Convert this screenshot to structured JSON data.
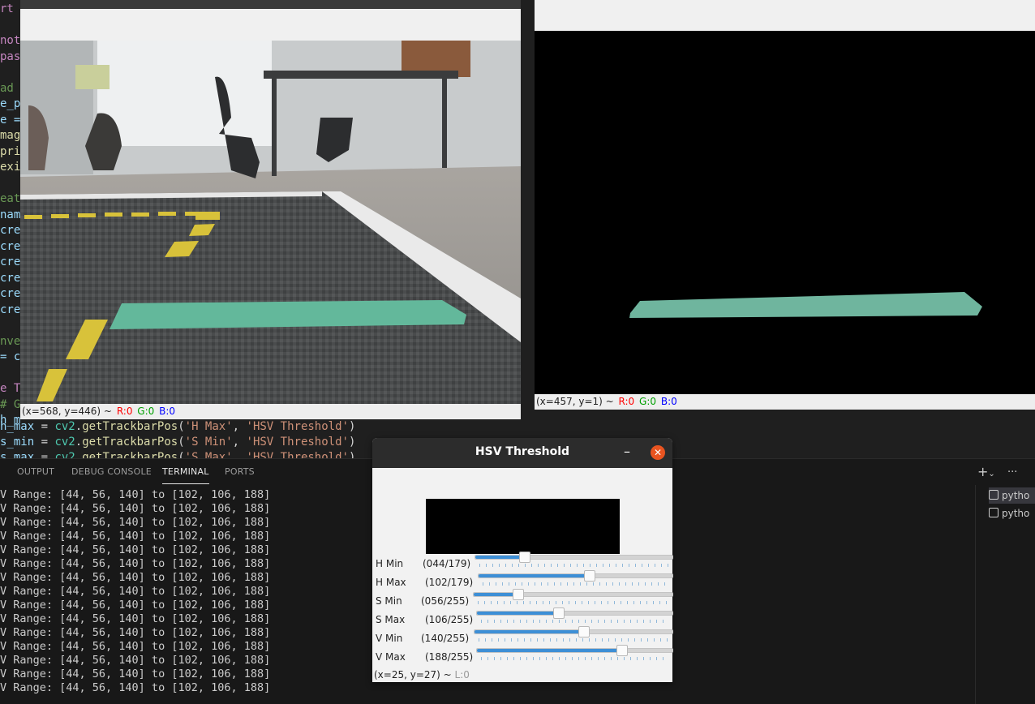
{
  "editor": {
    "lines": [
      {
        "t": "rt",
        "c": "#c586c0"
      },
      {
        "t": "",
        "c": "#d4d4d4"
      },
      {
        "t": "not",
        "c": "#c586c0"
      },
      {
        "t": "pas",
        "c": "#c586c0"
      },
      {
        "t": "",
        "c": "#d4d4d4"
      },
      {
        "t": "ad",
        "c": "#6a9955"
      },
      {
        "t": "e_p",
        "c": "#9cdcfe"
      },
      {
        "t": "e =",
        "c": "#9cdcfe"
      },
      {
        "t": "mag",
        "c": "#dcdcaa"
      },
      {
        "t": "pri",
        "c": "#dcdcaa"
      },
      {
        "t": "exi",
        "c": "#dcdcaa"
      },
      {
        "t": "",
        "c": "#d4d4d4"
      },
      {
        "t": "eat",
        "c": "#6a9955"
      },
      {
        "t": "nam",
        "c": "#9cdcfe"
      },
      {
        "t": "cre",
        "c": "#9cdcfe"
      },
      {
        "t": "cre",
        "c": "#9cdcfe"
      },
      {
        "t": "cre",
        "c": "#9cdcfe"
      },
      {
        "t": "cre",
        "c": "#9cdcfe"
      },
      {
        "t": "cre",
        "c": "#9cdcfe"
      },
      {
        "t": "cre",
        "c": "#9cdcfe"
      },
      {
        "t": "",
        "c": "#d4d4d4"
      },
      {
        "t": "nve",
        "c": "#6a9955"
      },
      {
        "t": "= c",
        "c": "#9cdcfe"
      },
      {
        "t": "",
        "c": "#d4d4d4"
      },
      {
        "t": "e T",
        "c": "#c586c0"
      },
      {
        "t": "# G",
        "c": "#6a9955"
      },
      {
        "t": "h_m",
        "c": "#9cdcfe"
      }
    ],
    "visible_code": [
      "h_max = cv2.getTrackbarPos('H Max', 'HSV Threshold')",
      "s_min = cv2.getTrackbarPos('S Min', 'HSV Threshold')",
      "s_max = cv2.getTrackbarPos('S Max', 'HSV Threshold')"
    ]
  },
  "panel": {
    "tabs": [
      "OUTPUT",
      "DEBUG CONSOLE",
      "TERMINAL",
      "PORTS"
    ],
    "active_tab": "TERMINAL",
    "actions": {
      "add": "+",
      "more": "···"
    },
    "terminal_lines": [
      "V Range: [44, 56, 140] to [102, 106, 188]",
      "V Range: [44, 56, 140] to [102, 106, 188]",
      "V Range: [44, 56, 140] to [102, 106, 188]",
      "V Range: [44, 56, 140] to [102, 106, 188]",
      "V Range: [44, 56, 140] to [102, 106, 188]",
      "V Range: [44, 56, 140] to [102, 106, 188]",
      "V Range: [44, 56, 140] to [102, 106, 188]",
      "V Range: [44, 56, 140] to [102, 106, 188]",
      "V Range: [44, 56, 140] to [102, 106, 188]",
      "V Range: [44, 56, 140] to [102, 106, 188]",
      "V Range: [44, 56, 140] to [102, 106, 188]",
      "V Range: [44, 56, 140] to [102, 106, 188]",
      "V Range: [44, 56, 140] to [102, 106, 188]",
      "V Range: [44, 56, 140] to [102, 106, 188]",
      "V Range: [44, 56, 140] to [102, 106, 188]"
    ],
    "terminal_list": [
      "pytho",
      "pytho"
    ]
  },
  "original_window": {
    "status": {
      "coords": "(x=568, y=446) ~",
      "r": "R:0",
      "g": "G:0",
      "b": "B:0"
    }
  },
  "mask_window": {
    "status": {
      "coords": "(x=457, y=1) ~",
      "r": "R:0",
      "g": "G:0",
      "b": "B:0"
    }
  },
  "hsv_window": {
    "title": "HSV Threshold",
    "minimize": "–",
    "close": "✕",
    "trackbars": [
      {
        "label": "H Min",
        "display": "(044/179)",
        "value": 44,
        "max": 179
      },
      {
        "label": "H Max",
        "display": "(102/179)",
        "value": 102,
        "max": 179
      },
      {
        "label": "S Min",
        "display": "(056/255)",
        "value": 56,
        "max": 255
      },
      {
        "label": "S Max",
        "display": "(106/255)",
        "value": 106,
        "max": 255
      },
      {
        "label": "V Min",
        "display": "(140/255)",
        "value": 140,
        "max": 255
      },
      {
        "label": "V Max",
        "display": "(188/255)",
        "value": 188,
        "max": 255
      }
    ],
    "status": {
      "coords": "(x=25, y=27) ~",
      "l": "L:0"
    }
  },
  "colors": {
    "accent": "#3d8fd6",
    "close": "#e95420",
    "tape": "#63b89b"
  }
}
